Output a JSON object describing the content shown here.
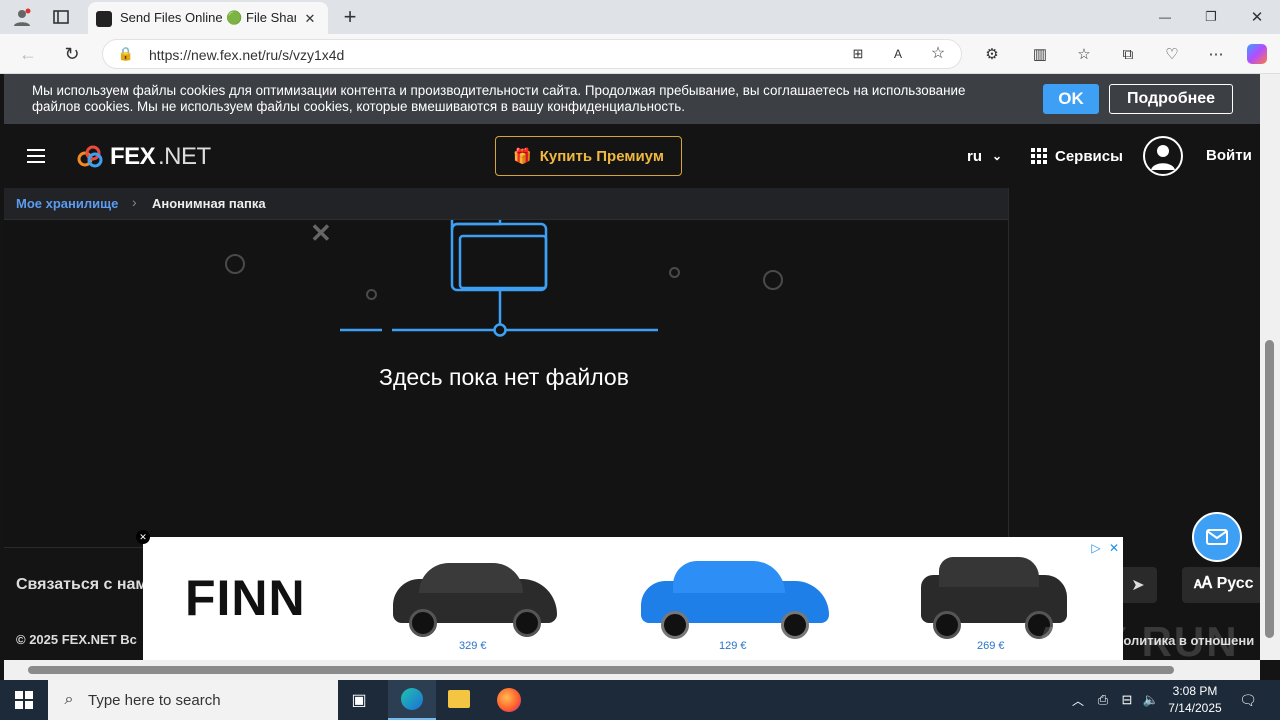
{
  "browser": {
    "tab_title": "Send Files Online 🟢 File Sharing",
    "url": "https://new.fex.net/ru/s/vzy1x4d",
    "new_tab": "+",
    "minimize": "—",
    "maximize": "❐",
    "close": "✕"
  },
  "cookie": {
    "text_line1": "Мы используем файлы cookies для оптимизации контента и производительности сайта. Продолжая пребывание, вы соглашаетесь на использование",
    "text_line2": "файлов cookies. Мы не используем файлы cookies, которые вмешиваются в вашу конфиденциальность.",
    "ok_label": "OK",
    "more_label": "Подробнее"
  },
  "header": {
    "logo_fex": "FEX",
    "logo_net": ".NET",
    "premium_label": "Купить Премиум",
    "lang": "ru",
    "services_label": "Сервисы",
    "login_label": "Войти"
  },
  "breadcrumb": {
    "root": "Мое хранилище",
    "current": "Анонимная папка"
  },
  "empty": {
    "message": "Здесь пока нет файлов"
  },
  "footer": {
    "contact": "Связаться с нам",
    "copyright": "© 2025 FEX.NET Вс",
    "privacy": "Политика в отношени",
    "lang_button": "Русс"
  },
  "ad": {
    "brand": "FINN",
    "prices": [
      "329 €",
      "129 €",
      "269 €"
    ]
  },
  "taskbar": {
    "search_placeholder": "Type here to search",
    "time": "3:08 PM",
    "date": "7/14/2025"
  },
  "watermark": "ANY RUN",
  "colors": {
    "accent_blue": "#3da0f5",
    "premium_gold": "#f0b840",
    "link_blue": "#5b9cf0"
  }
}
